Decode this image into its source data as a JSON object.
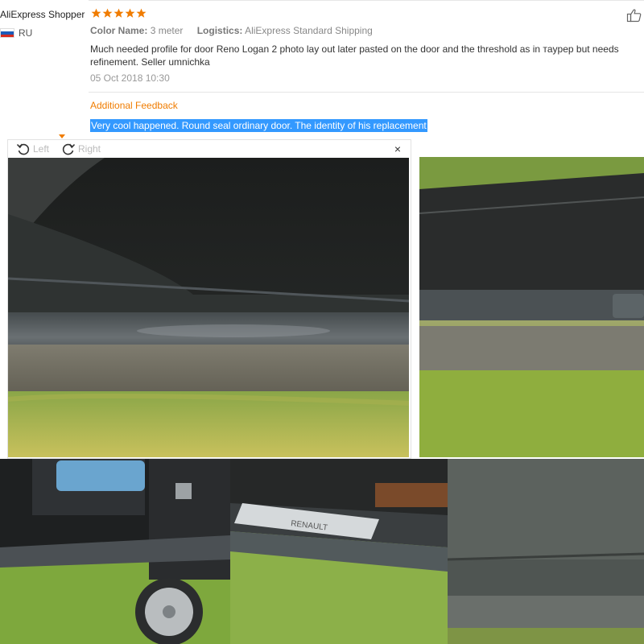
{
  "review": {
    "reviewer_name": "AliExpress Shopper",
    "rating_stars": 5,
    "country_code": "RU",
    "country_flag_colors": [
      "#ffffff",
      "#1c5bb8",
      "#d52b1e"
    ],
    "color_name_label": "Color Name:",
    "color_name_value": "3 meter",
    "logistics_label": "Logistics:",
    "logistics_value": "AliExpress Standard Shipping",
    "text": "Much needed profile for door Reno Logan 2 photo lay out later pasted on the door and the threshold as in тaypeр but needs refinement. Seller umnichka",
    "date": "05 Oct 2018 10:30",
    "star_color": "#f07c00"
  },
  "additional_feedback": {
    "title": "Additional Feedback",
    "text": "Very cool happened. Round seal ordinary door. The identity of his replacement",
    "highlight_color": "#3399ff"
  },
  "viewer": {
    "rotate_left_label": "Left",
    "rotate_right_label": "Right",
    "close_glyph": "×"
  },
  "photos": [
    {
      "id": "photo-main",
      "subject": "door sill with rubber seal, close-up",
      "emblem_text": ""
    },
    {
      "id": "photo-side",
      "subject": "rubber seal on sill edge",
      "emblem_text": ""
    },
    {
      "id": "photo-interior",
      "subject": "open rear door with child seat",
      "emblem_text": ""
    },
    {
      "id": "photo-threshold",
      "subject": "door threshold with Renault plate",
      "emblem_text": "RENAULT"
    },
    {
      "id": "photo-texture",
      "subject": "dusty door panel close-up",
      "emblem_text": ""
    }
  ]
}
